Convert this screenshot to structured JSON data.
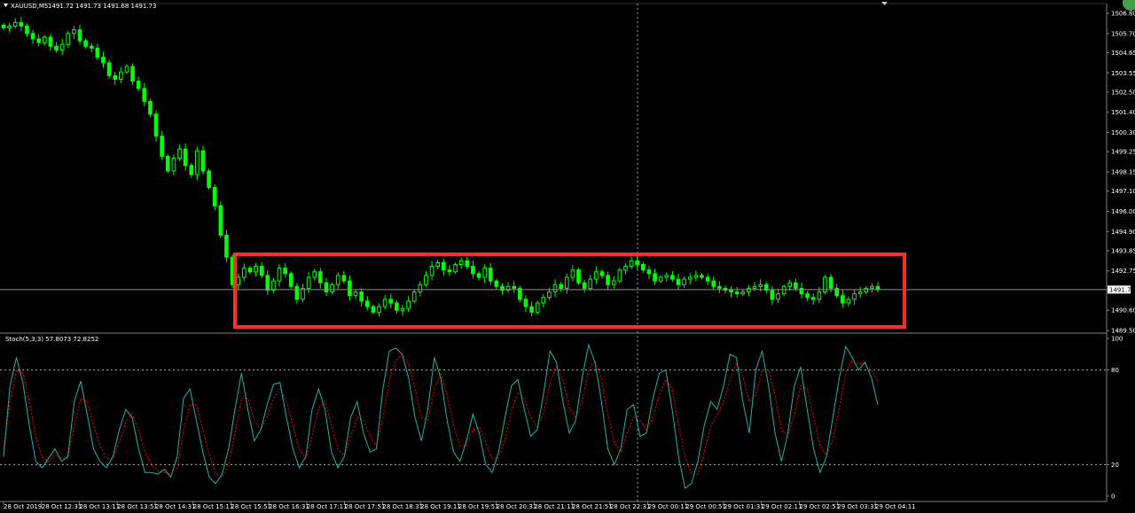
{
  "header": {
    "symbol": "XAUUSD,M5",
    "ohlc": "1491.72 1491.73 1491.68 1491.73",
    "current_price": "1491.73"
  },
  "stoch": {
    "label": "Stoch(5,3,3) 57.8073 72.8252"
  },
  "colors": {
    "background": "#000000",
    "candle": "#00ff00",
    "frame": "#ff2d2d",
    "stoch_main": "#20b2aa",
    "stoch_signal": "#ff0000",
    "axis": "#808080",
    "badge": "#43a047"
  },
  "chart_data": [
    {
      "type": "candlestick",
      "ylim": [
        1489.5,
        1506.8
      ],
      "y_ticks": [
        "1506.80",
        "1505.70",
        "1504.65",
        "1503.55",
        "1502.50",
        "1501.40",
        "1500.30",
        "1499.25",
        "1498.15",
        "1497.10",
        "1496.00",
        "1494.90",
        "1493.85",
        "1492.75",
        "1490.60",
        "1489.50"
      ],
      "x_ticks": [
        "28 Oct 2019",
        "28 Oct 12:31",
        "28 Oct 13:11",
        "28 Oct 13:51",
        "28 Oct 14:31",
        "28 Oct 15:11",
        "28 Oct 15:51",
        "28 Oct 16:31",
        "28 Oct 17:11",
        "28 Oct 17:51",
        "28 Oct 18:31",
        "28 Oct 19:11",
        "28 Oct 19:51",
        "28 Oct 20:31",
        "28 Oct 21:11",
        "28 Oct 21:51",
        "28 Oct 22:31",
        "29 Oct 00:11",
        "29 Oct 00:51",
        "29 Oct 01:31",
        "29 Oct 02:11",
        "29 Oct 02:51",
        "29 Oct 03:31",
        "29 Oct 04:11"
      ],
      "closes": [
        1506.0,
        1506.1,
        1506.3,
        1506.1,
        1505.7,
        1505.4,
        1505.2,
        1505.5,
        1505.0,
        1504.8,
        1505.1,
        1505.7,
        1505.9,
        1505.3,
        1505.0,
        1504.9,
        1504.4,
        1504.1,
        1503.4,
        1503.2,
        1503.6,
        1503.9,
        1503.1,
        1502.7,
        1502.0,
        1501.3,
        1500.1,
        1499.0,
        1498.2,
        1498.9,
        1499.4,
        1498.5,
        1498.0,
        1499.3,
        1498.2,
        1497.3,
        1496.3,
        1494.7,
        1493.5,
        1492.0,
        1492.4,
        1492.9,
        1492.7,
        1493.0,
        1492.5,
        1491.7,
        1492.2,
        1492.9,
        1492.6,
        1491.9,
        1491.2,
        1491.8,
        1492.4,
        1492.7,
        1492.1,
        1491.6,
        1492.0,
        1492.5,
        1492.2,
        1491.4,
        1491.6,
        1491.1,
        1490.8,
        1490.5,
        1490.8,
        1491.2,
        1491.0,
        1490.6,
        1490.7,
        1491.1,
        1491.6,
        1492.0,
        1492.5,
        1493.0,
        1493.2,
        1492.8,
        1492.7,
        1493.1,
        1493.3,
        1493.0,
        1492.6,
        1492.4,
        1492.9,
        1492.2,
        1491.9,
        1491.7,
        1491.9,
        1491.8,
        1491.2,
        1490.8,
        1490.5,
        1491.0,
        1491.3,
        1491.6,
        1492.0,
        1491.8,
        1492.4,
        1492.8,
        1492.1,
        1491.8,
        1492.3,
        1492.7,
        1492.5,
        1492.0,
        1492.2,
        1492.8,
        1493.0,
        1493.3,
        1493.1,
        1492.8,
        1492.6,
        1492.2,
        1492.4,
        1492.5,
        1492.3,
        1492.0,
        1492.3,
        1492.4,
        1492.5,
        1492.4,
        1492.2,
        1491.9,
        1491.8,
        1491.7,
        1491.6,
        1491.5,
        1491.6,
        1491.8,
        1491.9,
        1492.0,
        1491.7,
        1491.2,
        1491.5,
        1491.9,
        1492.1,
        1491.8,
        1491.5,
        1491.3,
        1491.2,
        1491.6,
        1492.4,
        1491.8,
        1491.4,
        1491.0,
        1491.2,
        1491.5,
        1491.6,
        1491.8,
        1491.9,
        1491.73
      ],
      "price_marker": 1491.73
    },
    {
      "type": "line",
      "ylim": [
        0,
        100
      ],
      "y_ticks": [
        "100",
        "80",
        "20",
        "0"
      ],
      "levels": [
        80,
        20
      ],
      "series": [
        {
          "values": [
            25,
            70,
            88,
            72,
            45,
            22,
            18,
            24,
            30,
            22,
            25,
            60,
            73,
            52,
            30,
            22,
            18,
            25,
            42,
            55,
            50,
            30,
            15,
            15,
            14,
            17,
            12,
            25,
            62,
            68,
            48,
            28,
            12,
            8,
            14,
            30,
            55,
            78,
            55,
            35,
            42,
            58,
            71,
            72,
            50,
            30,
            18,
            25,
            55,
            68,
            55,
            28,
            18,
            25,
            50,
            60,
            40,
            28,
            30,
            68,
            92,
            94,
            90,
            75,
            50,
            35,
            55,
            88,
            75,
            48,
            28,
            22,
            35,
            52,
            40,
            20,
            15,
            28,
            50,
            70,
            74,
            55,
            38,
            42,
            65,
            92,
            85,
            60,
            40,
            48,
            75,
            96,
            85,
            60,
            30,
            20,
            30,
            55,
            58,
            38,
            40,
            62,
            78,
            80,
            55,
            25,
            5,
            8,
            22,
            45,
            60,
            55,
            70,
            90,
            88,
            60,
            40,
            80,
            92,
            70,
            40,
            22,
            40,
            70,
            82,
            55,
            30,
            15,
            25,
            50,
            75,
            95,
            88,
            80,
            85,
            75,
            57.8
          ]
        },
        {
          "values": [
            30,
            60,
            80,
            78,
            60,
            38,
            25,
            22,
            26,
            24,
            24,
            45,
            62,
            60,
            45,
            32,
            24,
            24,
            34,
            47,
            52,
            42,
            28,
            20,
            16,
            15,
            14,
            18,
            42,
            58,
            58,
            42,
            26,
            14,
            12,
            20,
            40,
            62,
            62,
            48,
            42,
            50,
            62,
            68,
            60,
            45,
            30,
            24,
            38,
            56,
            60,
            45,
            30,
            26,
            38,
            50,
            48,
            38,
            32,
            50,
            74,
            86,
            90,
            84,
            68,
            50,
            48,
            68,
            78,
            64,
            45,
            32,
            32,
            42,
            44,
            34,
            24,
            24,
            36,
            54,
            66,
            62,
            50,
            44,
            52,
            72,
            82,
            74,
            56,
            50,
            60,
            80,
            86,
            74,
            52,
            34,
            28,
            40,
            50,
            48,
            42,
            50,
            64,
            74,
            68,
            45,
            25,
            14,
            14,
            28,
            44,
            52,
            60,
            74,
            84,
            76,
            60,
            64,
            80,
            80,
            64,
            42,
            38,
            52,
            70,
            68,
            50,
            32,
            26,
            36,
            56,
            78,
            86,
            84,
            84,
            80,
            72.8
          ]
        }
      ]
    }
  ]
}
